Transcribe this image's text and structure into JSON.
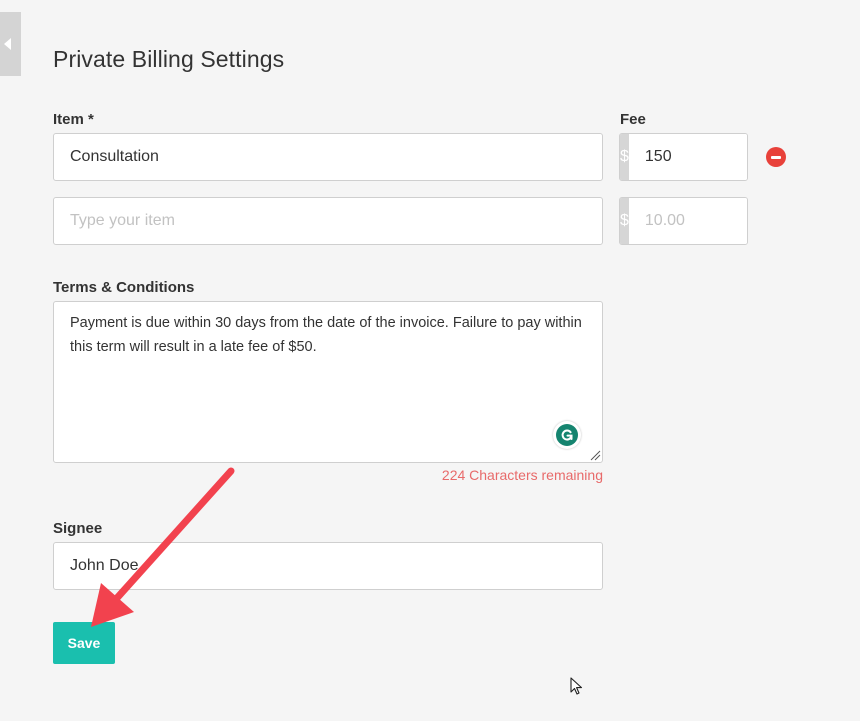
{
  "page": {
    "title": "Private Billing Settings"
  },
  "items": {
    "item_label": "Item *",
    "fee_label": "Fee",
    "currency_symbol": "$",
    "rows": [
      {
        "item_value": "Consultation",
        "item_placeholder": "",
        "fee_value": "150",
        "fee_placeholder": ""
      },
      {
        "item_value": "",
        "item_placeholder": "Type your item",
        "fee_value": "",
        "fee_placeholder": "10.00"
      }
    ]
  },
  "terms": {
    "label": "Terms & Conditions",
    "value": "Payment is due within 30 days from the date of the invoice. Failure to pay within this term will result in a late fee of $50.",
    "chars_remaining": "224 Characters remaining"
  },
  "signee": {
    "label": "Signee",
    "value": "John Doe"
  },
  "actions": {
    "save_label": "Save"
  },
  "colors": {
    "accent": "#1abfae",
    "danger": "#e8413a",
    "warning_text": "#e86a6a",
    "annotation_arrow": "#f2424e",
    "grammarly": "#15846f"
  },
  "icons": {
    "collapse": "caret-left-icon",
    "remove": "minus-circle-icon",
    "grammarly": "grammarly-icon",
    "resize": "resize-handle-icon",
    "cursor": "mouse-pointer-icon"
  }
}
